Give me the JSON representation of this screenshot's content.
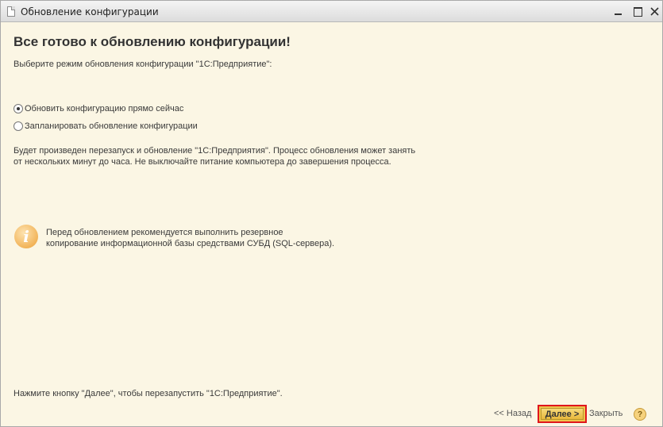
{
  "window": {
    "title": "Обновление конфигурации"
  },
  "main": {
    "heading": "Все готово к обновлению конфигурации!",
    "prompt": "Выберите режим обновления конфигурации \"1С:Предприятие\":",
    "options": [
      {
        "label": "Обновить конфигурацию прямо сейчас",
        "checked": true
      },
      {
        "label": "Запланировать обновление конфигурации",
        "checked": false
      }
    ],
    "description_lines": [
      "Будет произведен перезапуск и обновление \"1С:Предприятия\". Процесс обновления может занять",
      "от нескольких минут до часа. Не выключайте питание компьютера до завершения процесса."
    ],
    "info": {
      "icon": "info-icon",
      "lines": [
        "Перед обновлением рекомендуется выполнить резервное",
        "копирование информационной базы средствами СУБД (SQL-сервера)."
      ]
    },
    "footer_hint": "Нажмите кнопку \"Далее\", чтобы перезапустить \"1С:Предприятие\"."
  },
  "footer": {
    "back_label": "<< Назад",
    "next_label": "Далее >",
    "close_label": "Закрыть",
    "help_label": "?"
  },
  "colors": {
    "background": "#fbf6e4",
    "next_button": "#efc44d",
    "highlight_border": "#e0161c"
  }
}
